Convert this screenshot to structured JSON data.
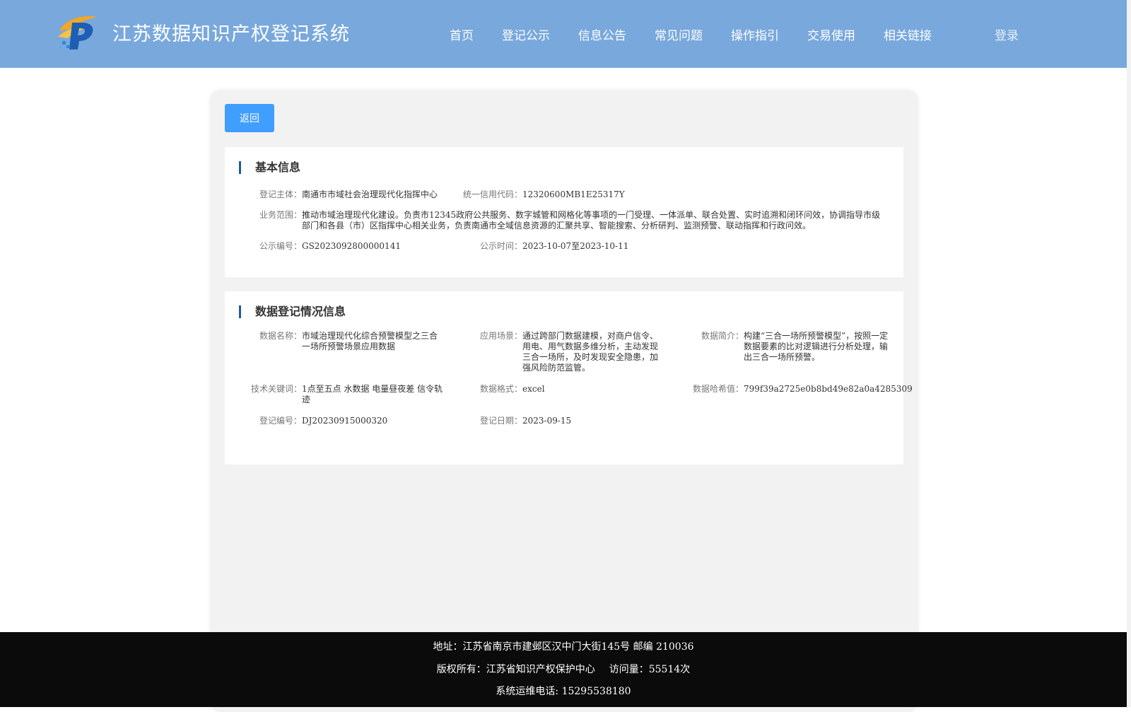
{
  "header": {
    "title": "江苏数据知识产权登记系统",
    "nav": [
      "首页",
      "登记公示",
      "信息公告",
      "常见问题",
      "操作指引",
      "交易使用",
      "相关链接"
    ],
    "login": "登录",
    "logo_icon": "jiangsu-ip-logo",
    "bg_color": "#79a8dc"
  },
  "back_button": "返回",
  "basic": {
    "title": "基本信息",
    "subject_label": "登记主体：",
    "subject": "南通市市域社会治理现代化指挥中心",
    "credit_label": "统一信用代码：",
    "credit": "12320600MB1E25317Y",
    "scope_label": "业务范围：",
    "scope": "推动市域治理现代化建设。负责市12345政府公共服务、数字城管和网格化等事项的一门受理、一体派单、联合处置、实时追溯和闭环问效，协调指导市级部门和各县（市）区指挥中心相关业务，负责南通市全域信息资源的汇聚共享、智能搜索、分析研判、监测预警、联动指挥和行政问效。",
    "pub_no_label": "公示编号：",
    "pub_no": "GS2023092800000141",
    "pub_time_label": "公示时间：",
    "pub_time": "2023-10-07至2023-10-11"
  },
  "registration": {
    "title": "数据登记情况信息",
    "name_label": "数据名称：",
    "name": "市域治理现代化综合预警模型之三合一场所预警场景应用数据",
    "scene_label": "应用场景：",
    "scene": "通过跨部门数据建模，对商户信令、用电、用气数据多维分析，主动发现三合一场所，及时发现安全隐患，加强风险防范监管。",
    "intro_label": "数据简介：",
    "intro": "构建“三合一场所预警模型”，按照一定数据要素的比对逻辑进行分析处理，输出三合一场所预警。",
    "keywords_label": "技术关键词：",
    "keywords": "1点至五点 水数据 电量昼夜差 信令轨迹",
    "format_label": "数据格式：",
    "format": "excel",
    "hash_label": "数据哈希值：",
    "hash": "799f39a2725e0b8bd49e82a0a4285309",
    "reg_no_label": "登记编号：",
    "reg_no": "DJ20230915000320",
    "reg_date_label": "登记日期：",
    "reg_date": "2023-09-15"
  },
  "footer": {
    "address": "地址：江苏省南京市建邺区汉中门大街145号 邮编 210036",
    "copyright": "版权所有：江苏省知识产权保护中心",
    "visits": "访问量：55514次",
    "phone": "系统运维电话: 15295538180"
  }
}
